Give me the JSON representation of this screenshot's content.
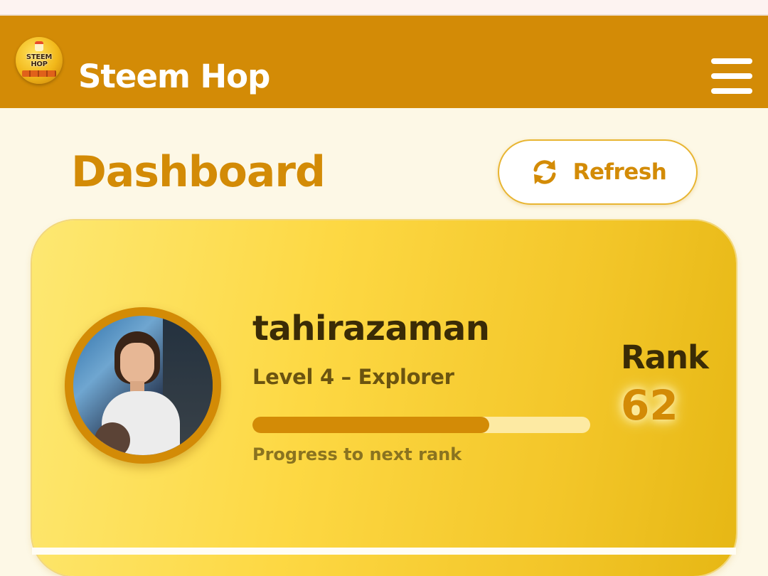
{
  "app": {
    "name": "Steem Hop",
    "logo_text": "STEEM HOP"
  },
  "header": {
    "menu_icon": "hamburger-menu-icon"
  },
  "page": {
    "title": "Dashboard",
    "refresh_label": "Refresh",
    "refresh_icon": "refresh-icon"
  },
  "profile": {
    "username": "tahirazaman",
    "level_text": "Level 4 – Explorer",
    "progress_fraction": 0.7,
    "progress_caption": "Progress to next rank",
    "rank_label": "Rank",
    "rank_value": "62"
  },
  "colors": {
    "header_bg": "#d38b06",
    "accent": "#d38b06",
    "page_bg": "#fdf8e6",
    "card_gradient_start": "#fde872",
    "card_gradient_end": "#e6b714",
    "progress_track": "#fdeaa3",
    "text_dark": "#3a2b06"
  }
}
